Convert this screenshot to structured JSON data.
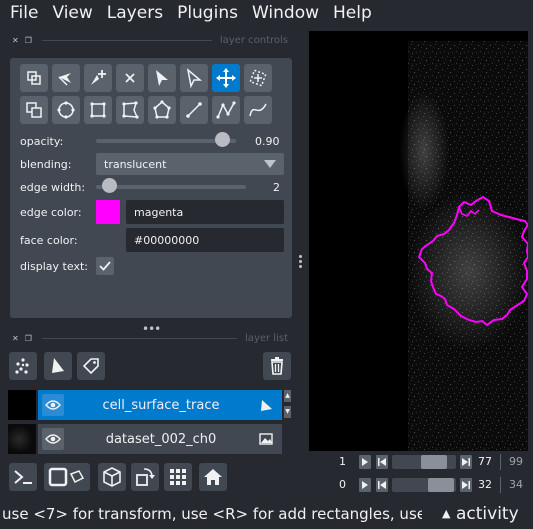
{
  "menu": [
    "File",
    "View",
    "Layers",
    "Plugins",
    "Window",
    "Help"
  ],
  "layer_controls": {
    "title": "layer controls",
    "tools_row1": [
      "select-vertices-icon",
      "direct-select-icon",
      "add-vertex-icon",
      "delete-shape-icon",
      "select-shapes-icon",
      "direct-select-vertex-icon",
      "pan-zoom-icon",
      "transform-icon"
    ],
    "tools_row2": [
      "move-back-icon",
      "ellipse-icon",
      "rectangle-icon",
      "polygon-icon",
      "polygon-lasso-icon",
      "line-icon",
      "path-icon",
      "polyline-icon"
    ],
    "active_tool": "pan-zoom-icon",
    "opacity_label": "opacity:",
    "opacity_value": "0.90",
    "opacity_fraction": 0.9,
    "blending_label": "blending:",
    "blending_value": "translucent",
    "edge_width_label": "edge width:",
    "edge_width_value": "2",
    "edge_width_fraction": 0.05,
    "edge_color_label": "edge color:",
    "edge_color_value": "magenta",
    "edge_color_hex": "#ff00ff",
    "face_color_label": "face color:",
    "face_color_value": "#00000000",
    "display_text_label": "display text:",
    "display_text_checked": true
  },
  "layer_list": {
    "title": "layer list",
    "layers": [
      {
        "name": "cell_surface_trace",
        "type": "shapes",
        "selected": true
      },
      {
        "name": "dataset_002_ch0",
        "type": "image",
        "selected": false
      }
    ]
  },
  "dims": [
    {
      "label": "1",
      "value": "77",
      "total": "99",
      "position": 0.77
    },
    {
      "label": "0",
      "value": "32",
      "total": "34",
      "position": 0.94
    }
  ],
  "status": {
    "message": "use <7> for transform, use <R> for add rectangles, use ...",
    "activity_label": "activity"
  },
  "colors": {
    "accent": "#007acc",
    "background": "#262930",
    "panel": "#414851",
    "shape_edge": "#ff00ff"
  }
}
